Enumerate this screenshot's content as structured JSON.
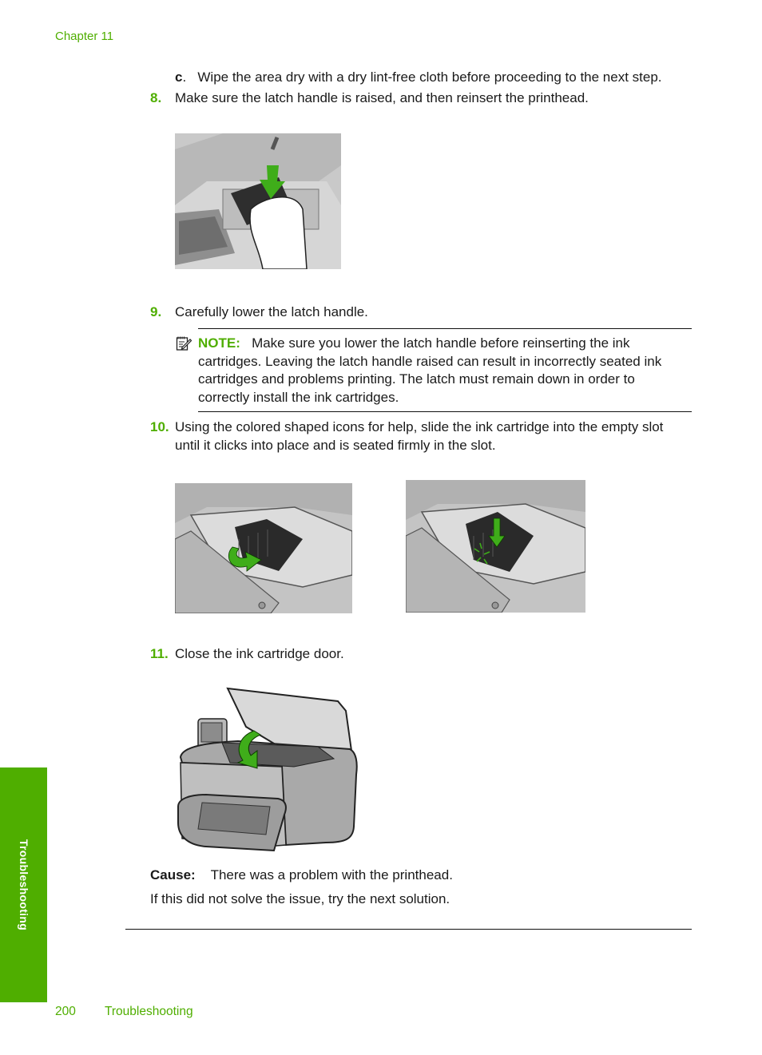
{
  "header": {
    "chapter": "Chapter 11"
  },
  "steps": {
    "sub_c": {
      "label": "c",
      "text": "Wipe the area dry with a dry lint-free cloth before proceeding to the next step."
    },
    "s8": {
      "number": "8.",
      "text": "Make sure the latch handle is raised, and then reinsert the printhead."
    },
    "s9": {
      "number": "9.",
      "text": "Carefully lower the latch handle."
    },
    "s10": {
      "number": "10.",
      "line1": "Using the colored shaped icons for help, slide the ink cartridge into the empty slot",
      "line2": "until it clicks into place and is seated firmly in the slot."
    },
    "s11": {
      "number": "11.",
      "text": "Close the ink cartridge door."
    }
  },
  "note": {
    "icon": "note-pad-pencil-icon",
    "label": "NOTE:",
    "lines": [
      "Make sure you lower the latch handle before reinserting the ink",
      "cartridges. Leaving the latch handle raised can result in incorrectly seated ink",
      "cartridges and problems printing. The latch must remain down in order to",
      "correctly install the ink cartridges."
    ]
  },
  "figures": {
    "printhead_insert": "Hand inserting printhead into carriage with green down arrow",
    "cartridge_slide": "Ink cartridge sliding into slot with green curved arrow",
    "cartridge_click": "Ink cartridge clicking into place with green down arrow",
    "close_door": "Printer with ink cartridge door being closed, green curved arrow"
  },
  "cause": {
    "label": "Cause:",
    "text": "There was a problem with the printhead."
  },
  "next_solution": "If this did not solve the issue, try the next solution.",
  "sidebar": {
    "label": "Troubleshooting"
  },
  "footer": {
    "page_number": "200",
    "section": "Troubleshooting"
  },
  "colors": {
    "accent": "#4fae00",
    "text": "#1a1a1a"
  }
}
